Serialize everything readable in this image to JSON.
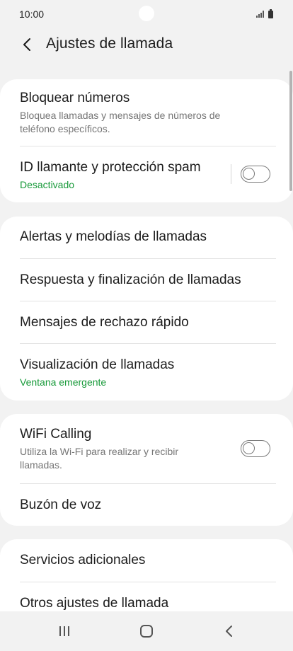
{
  "status_bar": {
    "time": "10:00"
  },
  "header": {
    "title": "Ajustes de llamada"
  },
  "groups": [
    {
      "items": [
        {
          "title": "Bloquear números",
          "subtitle": "Bloquea llamadas y mensajes de números de teléfono específicos."
        },
        {
          "title": "ID llamante y protección spam",
          "subtitle": "Desactivado",
          "toggle": false
        }
      ]
    },
    {
      "items": [
        {
          "title": "Alertas y melodías de llamadas"
        },
        {
          "title": "Respuesta y finalización de llamadas"
        },
        {
          "title": "Mensajes de rechazo rápido"
        },
        {
          "title": "Visualización de llamadas",
          "subtitle": "Ventana emergente"
        }
      ]
    },
    {
      "items": [
        {
          "title": "WiFi Calling",
          "subtitle": "Utiliza la Wi-Fi para realizar y recibir llamadas.",
          "toggle": false
        },
        {
          "title": "Buzón de voz"
        }
      ]
    },
    {
      "items": [
        {
          "title": "Servicios adicionales"
        },
        {
          "title": "Otros ajustes de llamada"
        }
      ]
    }
  ],
  "colors": {
    "accent": "#189a3a",
    "background": "#f2f2f2",
    "card": "#ffffff"
  }
}
